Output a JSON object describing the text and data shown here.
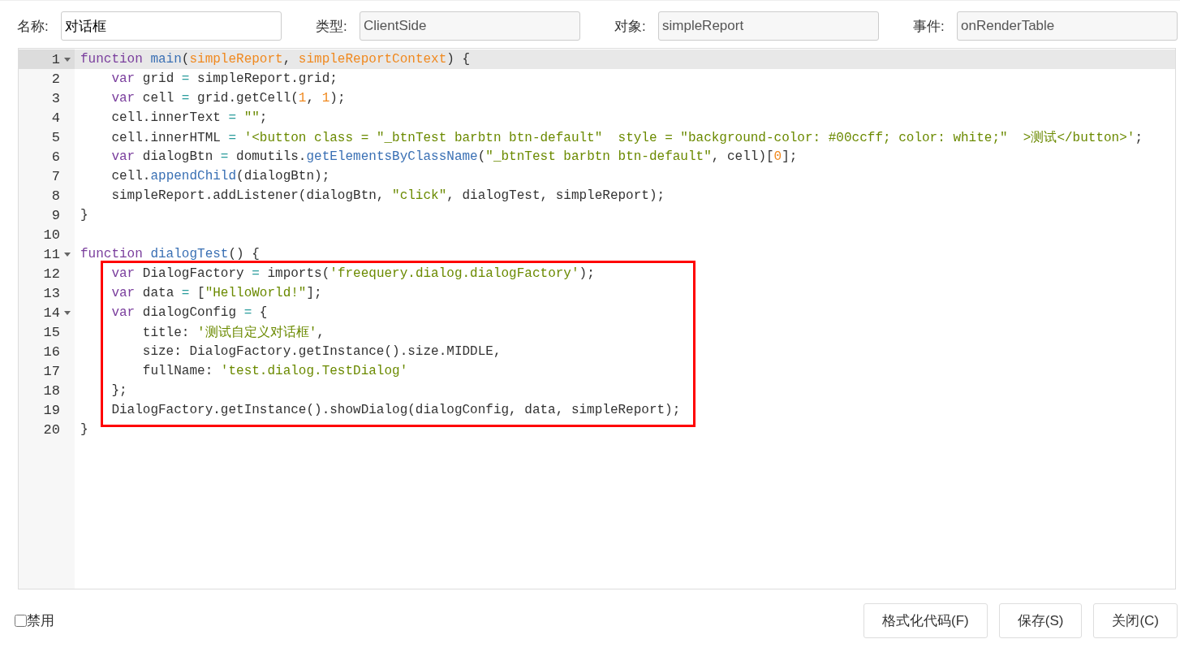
{
  "fields": [
    {
      "label": "名称:",
      "value": "对话框",
      "disabled": false
    },
    {
      "label": "类型:",
      "value": "ClientSide",
      "disabled": true
    },
    {
      "label": "对象:",
      "value": "simpleReport",
      "disabled": true
    },
    {
      "label": "事件:",
      "value": "onRenderTable",
      "disabled": true
    }
  ],
  "editor": {
    "lines": [
      {
        "number": "1",
        "fold": true,
        "active": true,
        "tokens": [
          {
            "kind": "keyword",
            "text": "function"
          },
          {
            "kind": "def",
            "text": " main"
          },
          {
            "kind": "plain",
            "text": "("
          },
          {
            "kind": "param",
            "text": "simpleReport"
          },
          {
            "kind": "plain",
            "text": ", "
          },
          {
            "kind": "param",
            "text": "simpleReportContext"
          },
          {
            "kind": "plain",
            "text": ") {"
          }
        ]
      },
      {
        "number": "2",
        "fold": false,
        "active": false,
        "tokens": [
          {
            "kind": "keyword",
            "text": "    var"
          },
          {
            "kind": "plain",
            "text": " grid "
          },
          {
            "kind": "operator",
            "text": "="
          },
          {
            "kind": "plain",
            "text": " simpleReport.grid;"
          }
        ]
      },
      {
        "number": "3",
        "fold": false,
        "active": false,
        "tokens": [
          {
            "kind": "keyword",
            "text": "    var"
          },
          {
            "kind": "plain",
            "text": " cell "
          },
          {
            "kind": "operator",
            "text": "="
          },
          {
            "kind": "plain",
            "text": " grid.getCell("
          },
          {
            "kind": "number",
            "text": "1"
          },
          {
            "kind": "plain",
            "text": ", "
          },
          {
            "kind": "number",
            "text": "1"
          },
          {
            "kind": "plain",
            "text": ");"
          }
        ]
      },
      {
        "number": "4",
        "fold": false,
        "active": false,
        "tokens": [
          {
            "kind": "plain",
            "text": "    cell.innerText "
          },
          {
            "kind": "operator",
            "text": "="
          },
          {
            "kind": "string",
            "text": " \"\""
          },
          {
            "kind": "plain",
            "text": ";"
          }
        ]
      },
      {
        "number": "5",
        "fold": false,
        "active": false,
        "tokens": [
          {
            "kind": "plain",
            "text": "    cell.innerHTML "
          },
          {
            "kind": "operator",
            "text": "="
          },
          {
            "kind": "string",
            "text": " '<button class = \"_btnTest barbtn btn-default\"  style = \"background-color: #00ccff; color: white;\"  >测试</button>'"
          },
          {
            "kind": "plain",
            "text": ";"
          }
        ]
      },
      {
        "number": "6",
        "fold": false,
        "active": false,
        "tokens": [
          {
            "kind": "keyword",
            "text": "    var"
          },
          {
            "kind": "plain",
            "text": " dialogBtn "
          },
          {
            "kind": "operator",
            "text": "="
          },
          {
            "kind": "plain",
            "text": " domutils."
          },
          {
            "kind": "property",
            "text": "getElementsByClassName"
          },
          {
            "kind": "plain",
            "text": "("
          },
          {
            "kind": "string",
            "text": "\"_btnTest barbtn btn-default\""
          },
          {
            "kind": "plain",
            "text": ", cell)["
          },
          {
            "kind": "number",
            "text": "0"
          },
          {
            "kind": "plain",
            "text": "];"
          }
        ]
      },
      {
        "number": "7",
        "fold": false,
        "active": false,
        "tokens": [
          {
            "kind": "plain",
            "text": "    cell."
          },
          {
            "kind": "property",
            "text": "appendChild"
          },
          {
            "kind": "plain",
            "text": "(dialogBtn);"
          }
        ]
      },
      {
        "number": "8",
        "fold": false,
        "active": false,
        "tokens": [
          {
            "kind": "plain",
            "text": "    simpleReport.addListener(dialogBtn, "
          },
          {
            "kind": "string",
            "text": "\"click\""
          },
          {
            "kind": "plain",
            "text": ", dialogTest, simpleReport);"
          }
        ]
      },
      {
        "number": "9",
        "fold": false,
        "active": false,
        "tokens": [
          {
            "kind": "plain",
            "text": "}"
          }
        ]
      },
      {
        "number": "10",
        "fold": false,
        "active": false
      },
      {
        "number": "11",
        "fold": true,
        "active": false,
        "tokens": [
          {
            "kind": "keyword",
            "text": "function"
          },
          {
            "kind": "def",
            "text": " dialogTest"
          },
          {
            "kind": "plain",
            "text": "() {"
          }
        ]
      }
    ],
    "highlight_box": {
      "lines": [
        {
          "number": "12",
          "fold": false,
          "active": false,
          "tokens": [
            {
              "kind": "keyword",
              "text": "    var"
            },
            {
              "kind": "plain",
              "text": " DialogFactory "
            },
            {
              "kind": "operator",
              "text": "="
            },
            {
              "kind": "plain",
              "text": " imports("
            },
            {
              "kind": "string",
              "text": "'freequery.dialog.dialogFactory'"
            },
            {
              "kind": "plain",
              "text": ");"
            }
          ]
        },
        {
          "number": "13",
          "fold": false,
          "active": false,
          "tokens": [
            {
              "kind": "keyword",
              "text": "    var"
            },
            {
              "kind": "plain",
              "text": " data "
            },
            {
              "kind": "operator",
              "text": "="
            },
            {
              "kind": "plain",
              "text": " ["
            },
            {
              "kind": "string",
              "text": "\"HelloWorld!\""
            },
            {
              "kind": "plain",
              "text": "];"
            }
          ]
        },
        {
          "number": "14",
          "fold": true,
          "active": false,
          "tokens": [
            {
              "kind": "keyword",
              "text": "    var"
            },
            {
              "kind": "plain",
              "text": " dialogConfig "
            },
            {
              "kind": "operator",
              "text": "="
            },
            {
              "kind": "plain",
              "text": " {"
            }
          ]
        },
        {
          "number": "15",
          "fold": false,
          "active": false,
          "tokens": [
            {
              "kind": "plain",
              "text": "        title: "
            },
            {
              "kind": "string",
              "text": "'测试自定义对话框'"
            },
            {
              "kind": "plain",
              "text": ","
            }
          ]
        },
        {
          "number": "16",
          "fold": false,
          "active": false,
          "tokens": [
            {
              "kind": "plain",
              "text": "        size: DialogFactory.getInstance().size.MIDDLE,"
            }
          ]
        },
        {
          "number": "17",
          "fold": false,
          "active": false,
          "tokens": [
            {
              "kind": "plain",
              "text": "        fullName: "
            },
            {
              "kind": "string",
              "text": "'test.dialog.TestDialog'"
            }
          ]
        },
        {
          "number": "18",
          "fold": false,
          "active": false,
          "tokens": [
            {
              "kind": "plain",
              "text": "    };"
            }
          ]
        },
        {
          "number": "19",
          "fold": false,
          "active": false,
          "tokens": [
            {
              "kind": "plain",
              "text": "    DialogFactory.getInstance().showDialog(dialogConfig, data, simpleReport);"
            }
          ]
        }
      ]
    },
    "lines_after": [
      {
        "number": "20",
        "fold": false,
        "active": false,
        "tokens": [
          {
            "kind": "plain",
            "text": "}"
          }
        ]
      }
    ]
  },
  "disable_checkbox": {
    "label": "禁用",
    "checked": false
  },
  "buttons": [
    "格式化代码(F)",
    "保存(S)",
    "关闭(C)"
  ]
}
